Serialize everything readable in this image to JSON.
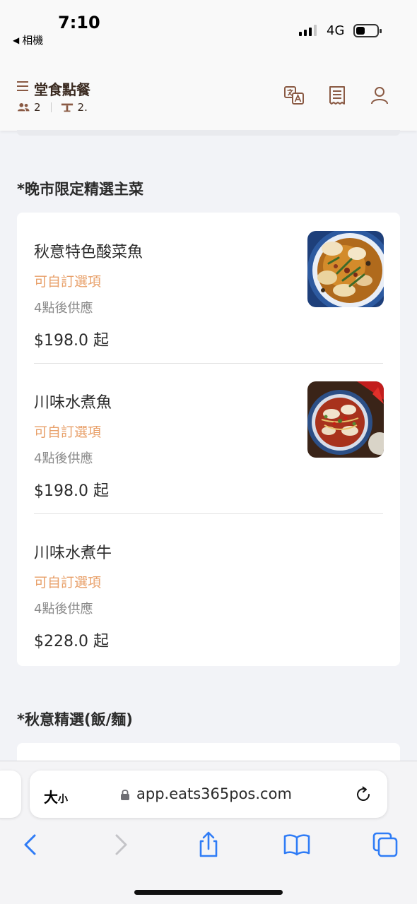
{
  "status_bar": {
    "time": "7:10",
    "back_label": "相機",
    "network": "4G"
  },
  "header": {
    "title": "堂食點餐",
    "guests": "2",
    "table": "2.",
    "icons": [
      "menu-icon",
      "people-icon",
      "table-icon",
      "translate-icon",
      "receipt-icon",
      "user-icon"
    ]
  },
  "sections": [
    {
      "title": "*晚市限定精選主菜",
      "items": [
        {
          "name": "秋意特色酸菜魚",
          "option": "可自訂選項",
          "time": "4點後供應",
          "price": "$198.0 起",
          "has_photo": true
        },
        {
          "name": "川味水煮魚",
          "option": "可自訂選項",
          "time": "4點後供應",
          "price": "$198.0 起",
          "has_photo": true
        },
        {
          "name": "川味水煮牛",
          "option": "可自訂選項",
          "time": "4點後供應",
          "price": "$228.0 起",
          "has_photo": false
        }
      ]
    },
    {
      "title": "*秋意精選(飯/麵)",
      "items": []
    }
  ],
  "browser": {
    "text_size_big": "大",
    "text_size_small": "小",
    "url": "app.eats365pos.com",
    "icons": [
      "lock-icon",
      "reload-icon",
      "back-icon",
      "forward-icon",
      "share-icon",
      "bookmarks-icon",
      "tabs-icon"
    ]
  },
  "colors": {
    "accent": "#8a5a44",
    "option_text": "#e8a06a",
    "ios_blue": "#2f7cf6"
  }
}
